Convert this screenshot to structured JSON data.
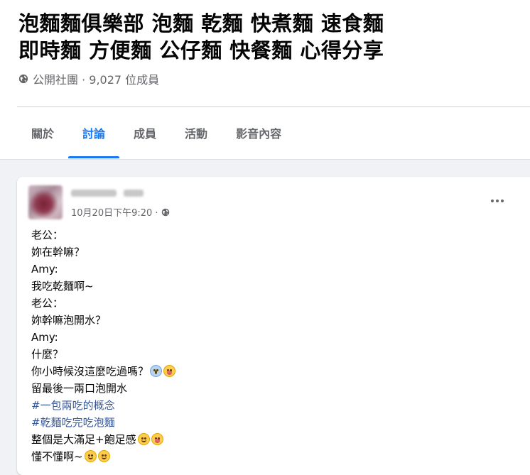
{
  "group": {
    "title_line1": "泡麵麵俱樂部 泡麵 乾麵 快煮麵 速食麵",
    "title_line2": "即時麵 方便麵 公仔麵 快餐麵 心得分享",
    "meta": "公開社團 · 9,027 位成員",
    "meta_icon": "globe-icon"
  },
  "tabs": [
    {
      "label": "關於",
      "active": false
    },
    {
      "label": "討論",
      "active": true
    },
    {
      "label": "成員",
      "active": false
    },
    {
      "label": "活動",
      "active": false
    },
    {
      "label": "影音內容",
      "active": false
    }
  ],
  "colors": {
    "accent": "#1877f2",
    "hashtag": "#385898",
    "secondary_text": "#65676b"
  },
  "post": {
    "timestamp": "10月20日下午9:20 ·",
    "privacy_icon": "globe-icon",
    "more_icon": "ellipsis-icon",
    "lines": [
      "老公：",
      "妳在幹嘛？",
      "Amy:",
      "我吃乾麵啊~",
      "老公：",
      "妳幹嘛泡開水？",
      "Amy:",
      "什麼？",
      "你小時候沒這麼吃過嗎？",
      "留最後一兩口泡開水",
      "#一包兩吃的概念",
      "#乾麵吃完吃泡麵",
      "整個是大滿足+飽足感",
      "懂不懂啊~"
    ]
  }
}
